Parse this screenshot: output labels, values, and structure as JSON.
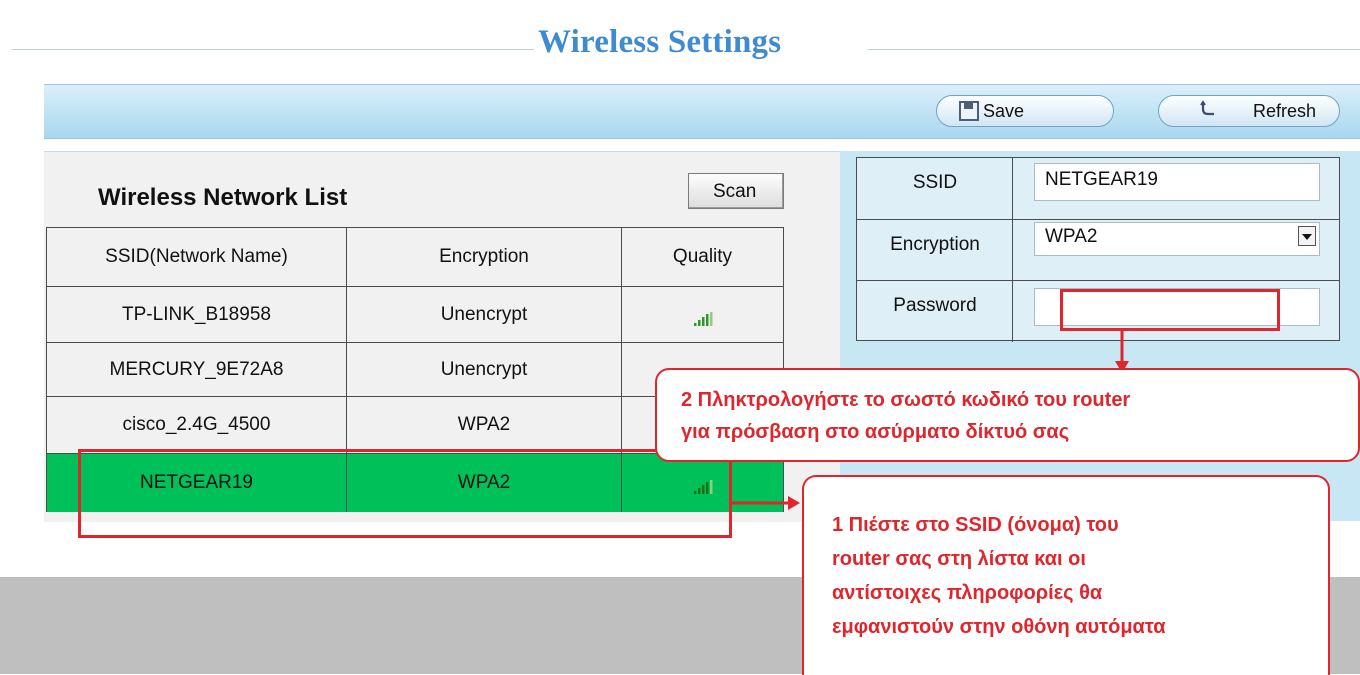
{
  "header": {
    "title": "Wireless Settings"
  },
  "toolbar": {
    "save_label": "Save",
    "refresh_label": "Refresh"
  },
  "network_list": {
    "title": "Wireless Network List",
    "scan_label": "Scan",
    "columns": [
      "SSID(Network Name)",
      "Encryption",
      "Quality"
    ],
    "rows": [
      {
        "ssid": "TP-LINK_B18958",
        "encryption": "Unencrypt",
        "quality": "signal-bars-icon"
      },
      {
        "ssid": "MERCURY_9E72A8",
        "encryption": "Unencrypt",
        "quality": ""
      },
      {
        "ssid": "cisco_2.4G_4500",
        "encryption": "WPA2",
        "quality": ""
      },
      {
        "ssid": "NETGEAR19",
        "encryption": "WPA2",
        "quality": "signal-bars-icon",
        "selected": true
      }
    ]
  },
  "form": {
    "ssid_label": "SSID",
    "ssid_value": "NETGEAR19",
    "encryption_label": "Encryption",
    "encryption_value": "WPA2",
    "password_label": "Password",
    "password_value": ""
  },
  "callouts": {
    "password_line1": "2 Πληκτρολογήστε το σωστό κωδικό του router",
    "password_line2": "για πρόσβαση στο ασύρματο δίκτυό σας",
    "ssid_line1": "1 Πιέστε στο SSID (όνομα) του",
    "ssid_line2": "router σας στη λίστα και οι",
    "ssid_line3": "αντίστοιχες πληροφορίες θα",
    "ssid_line4": "εμφανιστούν στην οθόνη αυτόματα"
  },
  "colors": {
    "title": "#3f8bd1",
    "selected_row": "#00c05a",
    "highlight": "#e0262d",
    "signal_bars": "#2e9a27",
    "toolbar": "#a9d7ee",
    "form_panel": "#c7e7f4",
    "bottom_band": "#bfbfbf"
  }
}
